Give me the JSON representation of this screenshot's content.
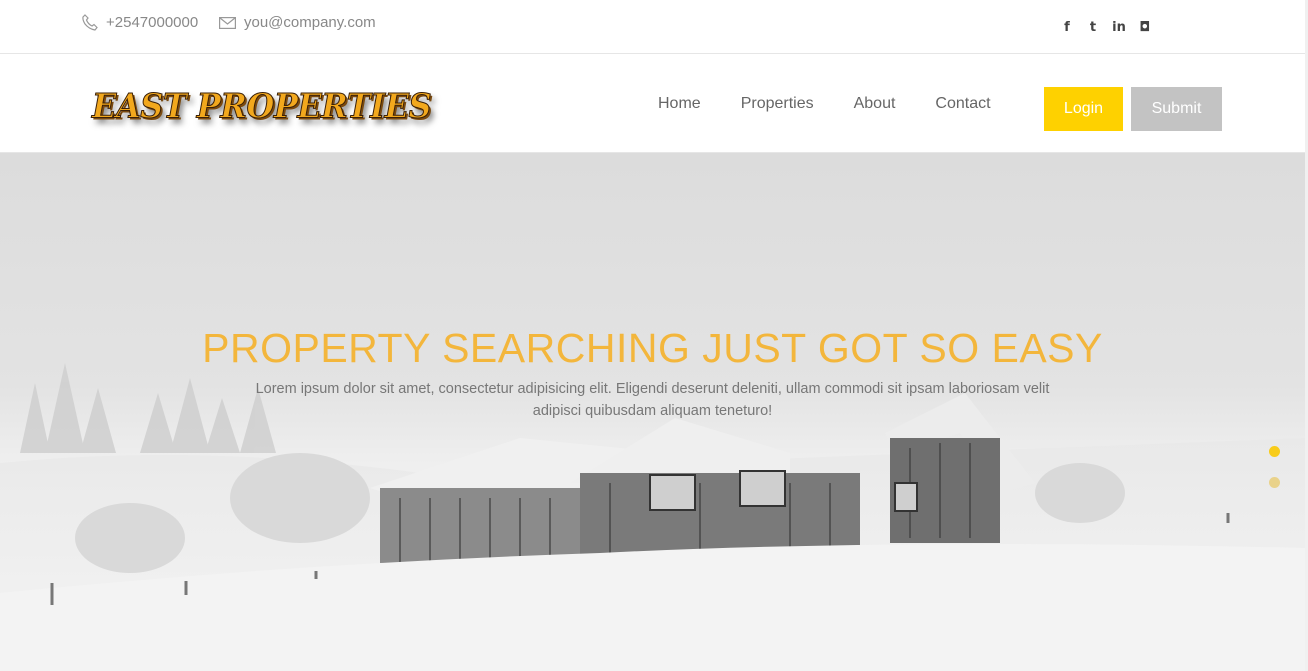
{
  "topbar": {
    "phone": "+2547000000",
    "email": "you@company.com",
    "social": [
      {
        "icon": "facebook-icon",
        "glyph": "f"
      },
      {
        "icon": "twitter-icon",
        "glyph": "t"
      },
      {
        "icon": "linkedin-icon",
        "glyph": "in"
      },
      {
        "icon": "instagram-icon",
        "glyph": "◘"
      }
    ]
  },
  "header": {
    "logo_text": "EAST PROPERTIES",
    "nav": [
      "Home",
      "Properties",
      "About",
      "Contact"
    ],
    "login_label": "Login",
    "submit_label": "Submit"
  },
  "hero": {
    "title": "PROPERTY SEARCHING JUST GOT SO EASY",
    "text": "Lorem ipsum dolor sit amet, consectetur adipisicing elit. Eligendi deserunt deleniti, ullam commodi sit ipsam laboriosam velit adipisci quibusdam aliquam teneturo!",
    "slider_dots": 2,
    "active_dot": 1
  },
  "colors": {
    "accent": "#fed100",
    "title": "#f3b63c",
    "submit_bg": "#c3c3c3"
  }
}
